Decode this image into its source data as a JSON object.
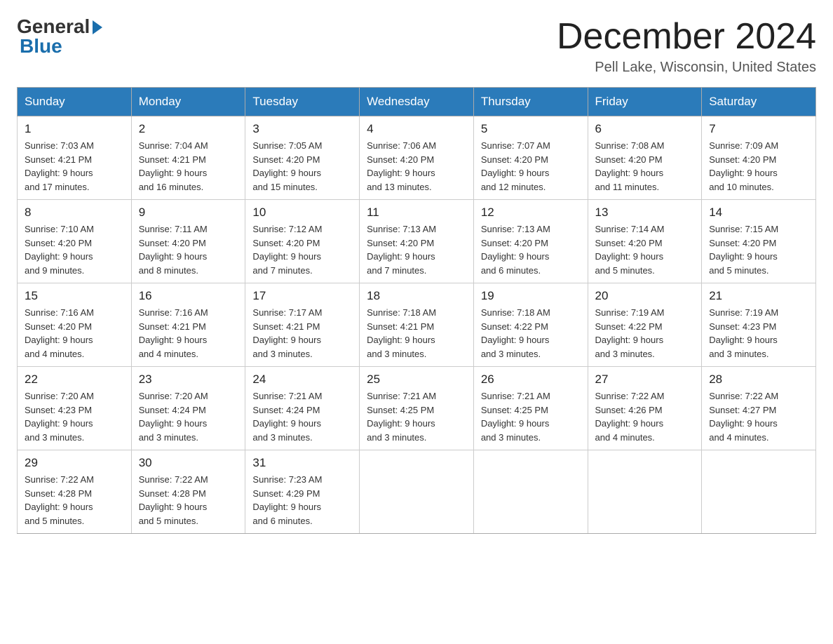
{
  "header": {
    "logo_general": "General",
    "logo_blue": "Blue",
    "month_title": "December 2024",
    "location": "Pell Lake, Wisconsin, United States"
  },
  "days_of_week": [
    "Sunday",
    "Monday",
    "Tuesday",
    "Wednesday",
    "Thursday",
    "Friday",
    "Saturday"
  ],
  "weeks": [
    [
      {
        "day": "1",
        "sunrise": "7:03 AM",
        "sunset": "4:21 PM",
        "daylight": "9 hours and 17 minutes."
      },
      {
        "day": "2",
        "sunrise": "7:04 AM",
        "sunset": "4:21 PM",
        "daylight": "9 hours and 16 minutes."
      },
      {
        "day": "3",
        "sunrise": "7:05 AM",
        "sunset": "4:20 PM",
        "daylight": "9 hours and 15 minutes."
      },
      {
        "day": "4",
        "sunrise": "7:06 AM",
        "sunset": "4:20 PM",
        "daylight": "9 hours and 13 minutes."
      },
      {
        "day": "5",
        "sunrise": "7:07 AM",
        "sunset": "4:20 PM",
        "daylight": "9 hours and 12 minutes."
      },
      {
        "day": "6",
        "sunrise": "7:08 AM",
        "sunset": "4:20 PM",
        "daylight": "9 hours and 11 minutes."
      },
      {
        "day": "7",
        "sunrise": "7:09 AM",
        "sunset": "4:20 PM",
        "daylight": "9 hours and 10 minutes."
      }
    ],
    [
      {
        "day": "8",
        "sunrise": "7:10 AM",
        "sunset": "4:20 PM",
        "daylight": "9 hours and 9 minutes."
      },
      {
        "day": "9",
        "sunrise": "7:11 AM",
        "sunset": "4:20 PM",
        "daylight": "9 hours and 8 minutes."
      },
      {
        "day": "10",
        "sunrise": "7:12 AM",
        "sunset": "4:20 PM",
        "daylight": "9 hours and 7 minutes."
      },
      {
        "day": "11",
        "sunrise": "7:13 AM",
        "sunset": "4:20 PM",
        "daylight": "9 hours and 7 minutes."
      },
      {
        "day": "12",
        "sunrise": "7:13 AM",
        "sunset": "4:20 PM",
        "daylight": "9 hours and 6 minutes."
      },
      {
        "day": "13",
        "sunrise": "7:14 AM",
        "sunset": "4:20 PM",
        "daylight": "9 hours and 5 minutes."
      },
      {
        "day": "14",
        "sunrise": "7:15 AM",
        "sunset": "4:20 PM",
        "daylight": "9 hours and 5 minutes."
      }
    ],
    [
      {
        "day": "15",
        "sunrise": "7:16 AM",
        "sunset": "4:20 PM",
        "daylight": "9 hours and 4 minutes."
      },
      {
        "day": "16",
        "sunrise": "7:16 AM",
        "sunset": "4:21 PM",
        "daylight": "9 hours and 4 minutes."
      },
      {
        "day": "17",
        "sunrise": "7:17 AM",
        "sunset": "4:21 PM",
        "daylight": "9 hours and 3 minutes."
      },
      {
        "day": "18",
        "sunrise": "7:18 AM",
        "sunset": "4:21 PM",
        "daylight": "9 hours and 3 minutes."
      },
      {
        "day": "19",
        "sunrise": "7:18 AM",
        "sunset": "4:22 PM",
        "daylight": "9 hours and 3 minutes."
      },
      {
        "day": "20",
        "sunrise": "7:19 AM",
        "sunset": "4:22 PM",
        "daylight": "9 hours and 3 minutes."
      },
      {
        "day": "21",
        "sunrise": "7:19 AM",
        "sunset": "4:23 PM",
        "daylight": "9 hours and 3 minutes."
      }
    ],
    [
      {
        "day": "22",
        "sunrise": "7:20 AM",
        "sunset": "4:23 PM",
        "daylight": "9 hours and 3 minutes."
      },
      {
        "day": "23",
        "sunrise": "7:20 AM",
        "sunset": "4:24 PM",
        "daylight": "9 hours and 3 minutes."
      },
      {
        "day": "24",
        "sunrise": "7:21 AM",
        "sunset": "4:24 PM",
        "daylight": "9 hours and 3 minutes."
      },
      {
        "day": "25",
        "sunrise": "7:21 AM",
        "sunset": "4:25 PM",
        "daylight": "9 hours and 3 minutes."
      },
      {
        "day": "26",
        "sunrise": "7:21 AM",
        "sunset": "4:25 PM",
        "daylight": "9 hours and 3 minutes."
      },
      {
        "day": "27",
        "sunrise": "7:22 AM",
        "sunset": "4:26 PM",
        "daylight": "9 hours and 4 minutes."
      },
      {
        "day": "28",
        "sunrise": "7:22 AM",
        "sunset": "4:27 PM",
        "daylight": "9 hours and 4 minutes."
      }
    ],
    [
      {
        "day": "29",
        "sunrise": "7:22 AM",
        "sunset": "4:28 PM",
        "daylight": "9 hours and 5 minutes."
      },
      {
        "day": "30",
        "sunrise": "7:22 AM",
        "sunset": "4:28 PM",
        "daylight": "9 hours and 5 minutes."
      },
      {
        "day": "31",
        "sunrise": "7:23 AM",
        "sunset": "4:29 PM",
        "daylight": "9 hours and 6 minutes."
      },
      null,
      null,
      null,
      null
    ]
  ]
}
